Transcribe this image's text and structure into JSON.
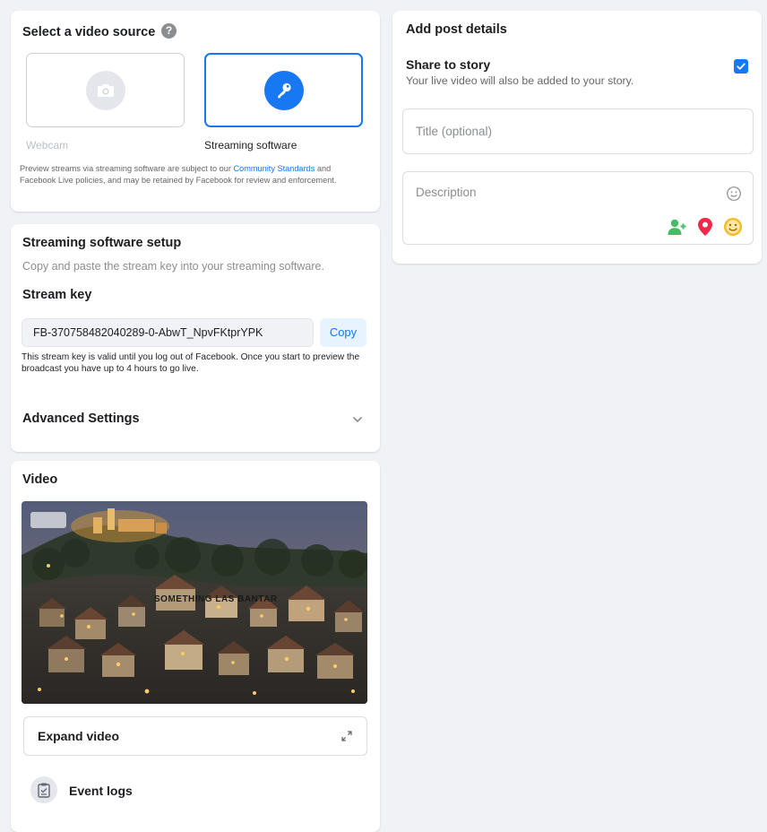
{
  "source": {
    "title": "Select a video source",
    "help_glyph": "?",
    "webcam_label": "Webcam",
    "streaming_label": "Streaming software",
    "note_before_link": "Preview streams via streaming software are subject to our ",
    "note_link": "Community Standards",
    "note_after_link": " and Facebook Live policies, and may be retained by Facebook for review and enforcement.",
    "selected": "Streaming software"
  },
  "setup": {
    "title": "Streaming software setup",
    "subtitle": "Copy and paste the stream key into your streaming software.",
    "key_label": "Stream key",
    "key_value": "FB-370758482040289-0-AbwT_NpvFKtprYPK",
    "copy_label": "Copy",
    "key_note": "This stream key is valid until you log out of Facebook. Once you start to preview the broadcast you have up to 4 hours to go live.",
    "advanced_label": "Advanced Settings"
  },
  "video": {
    "title": "Video",
    "expand_label": "Expand video",
    "event_logs_label": "Event logs",
    "overlay_caption": "SOMETHING LAS BANTAR"
  },
  "post": {
    "title": "Add post details",
    "share_label": "Share to story",
    "share_sub": "Your live video will also be added to your story.",
    "share_checked": true,
    "title_placeholder": "Title (optional)",
    "description_placeholder": "Description"
  },
  "icons": {
    "help": "question-icon",
    "webcam": "camera-icon",
    "streaming": "key-icon",
    "chevron": "chevron-down-icon",
    "expand": "expand-icon",
    "event_logs": "clipboard-icon",
    "tag_people": "tag-people-icon",
    "location": "location-pin-icon",
    "feeling": "feeling-emoji-icon",
    "emoji": "smile-outline-icon"
  },
  "colors": {
    "accent": "#1877f2",
    "background": "#f0f2f5",
    "tag_people": "#45bd62",
    "location": "#f02849",
    "feeling": "#f7b928"
  }
}
